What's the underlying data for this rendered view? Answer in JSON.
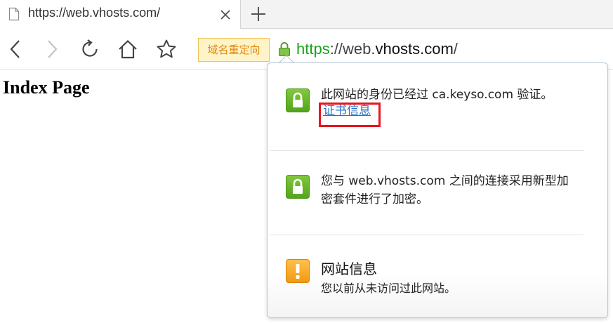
{
  "tab": {
    "title": "https://web.vhosts.com/",
    "favicon": "document-icon",
    "close_icon": "close-icon"
  },
  "new_tab_icon": "plus-icon",
  "toolbar": {
    "back_icon": "chevron-left-icon",
    "forward_icon": "chevron-right-icon",
    "reload_icon": "reload-icon",
    "home_icon": "home-icon",
    "bookmark_icon": "star-icon",
    "redirect_badge": "域名重定向",
    "lock_icon": "lock-icon",
    "url": {
      "scheme": "https",
      "middle": "://web.",
      "domain": "vhosts.com",
      "path": "/"
    }
  },
  "page": {
    "heading": "Index Page"
  },
  "security_popup": {
    "identity": {
      "text": "此网站的身份已经过 ca.keyso.com 验证。",
      "link": "证书信息",
      "icon": "lock-icon"
    },
    "connection": {
      "text_line1": "您与 web.vhosts.com 之间的连接采用新型加",
      "text_line2": "密套件进行了加密。",
      "icon": "lock-icon"
    },
    "site_info": {
      "title": "网站信息",
      "subtitle": "您以前从未访问过此网站。",
      "icon": "exclamation-icon"
    }
  },
  "colors": {
    "url_scheme": "#19a319",
    "badge_text": "#e08a10",
    "badge_bg": "#fff3c8",
    "link": "#2a73c9",
    "highlight": "#e8141d",
    "secure_icon": "#6bb82c",
    "warning_icon": "#f5a623"
  }
}
